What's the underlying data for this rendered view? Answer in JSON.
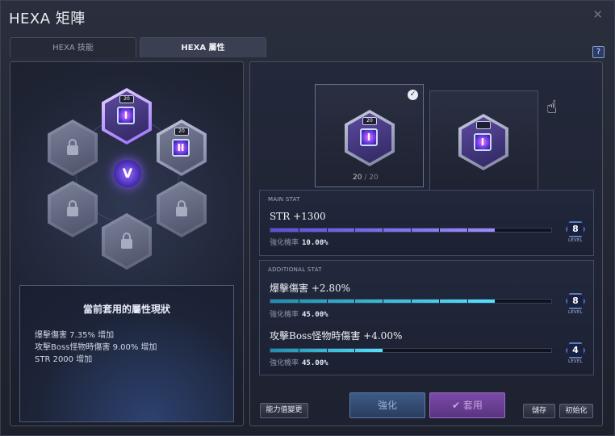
{
  "window": {
    "title": "HEXA 矩陣",
    "close_icon": "close-icon",
    "help_label": "?"
  },
  "tabs": [
    {
      "label": "HEXA 技能",
      "active": false
    },
    {
      "label": "HEXA 屬性",
      "active": true
    }
  ],
  "matrix": {
    "center_label": "V",
    "nodes": [
      {
        "position": "top",
        "state": "active",
        "level_tag": "20",
        "glyph": "I"
      },
      {
        "position": "upper-right",
        "state": "active",
        "level_tag": "20",
        "glyph": "II"
      },
      {
        "position": "upper-left",
        "state": "locked"
      },
      {
        "position": "lower-left",
        "state": "locked"
      },
      {
        "position": "lower-right",
        "state": "locked"
      },
      {
        "position": "bottom",
        "state": "locked"
      }
    ]
  },
  "status": {
    "title": "當前套用的屬性現狀",
    "lines": [
      "爆擊傷害 7.35% 增加",
      "攻擊Boss怪物時傷害 9.00% 增加",
      "STR 2000 增加"
    ]
  },
  "cards": {
    "current": {
      "level_tag": "20",
      "glyph": "I",
      "count": "20",
      "max": "/ 20",
      "selected": true
    },
    "next": {
      "level_tag": "",
      "glyph": "I"
    }
  },
  "main_stat": {
    "label": "MAIN STAT",
    "name": "STR +1300",
    "progress": 0.8,
    "prob_label": "強化機率",
    "prob_value": "10.00%",
    "level": "8",
    "level_word": "LEVEL"
  },
  "additional_stat": {
    "label": "ADDITIONAL STAT",
    "stats": [
      {
        "name": "爆擊傷害 +2.80%",
        "progress": 0.8,
        "prob_label": "強化機率",
        "prob_value": "45.00%",
        "level": "8",
        "level_word": "LEVEL"
      },
      {
        "name": "攻擊Boss怪物時傷害 +4.00%",
        "progress": 0.4,
        "prob_label": "強化機率",
        "prob_value": "45.00%",
        "level": "4",
        "level_word": "LEVEL"
      }
    ]
  },
  "buttons": {
    "ability_change": "能力值變更",
    "enhance": "強化",
    "apply": "套用",
    "save": "儲存",
    "reset": "初始化"
  },
  "colors": {
    "accent_purple": "#9b6bff",
    "bar_cyan": "#54e2ff",
    "bar_purple": "#7c6cf0"
  }
}
